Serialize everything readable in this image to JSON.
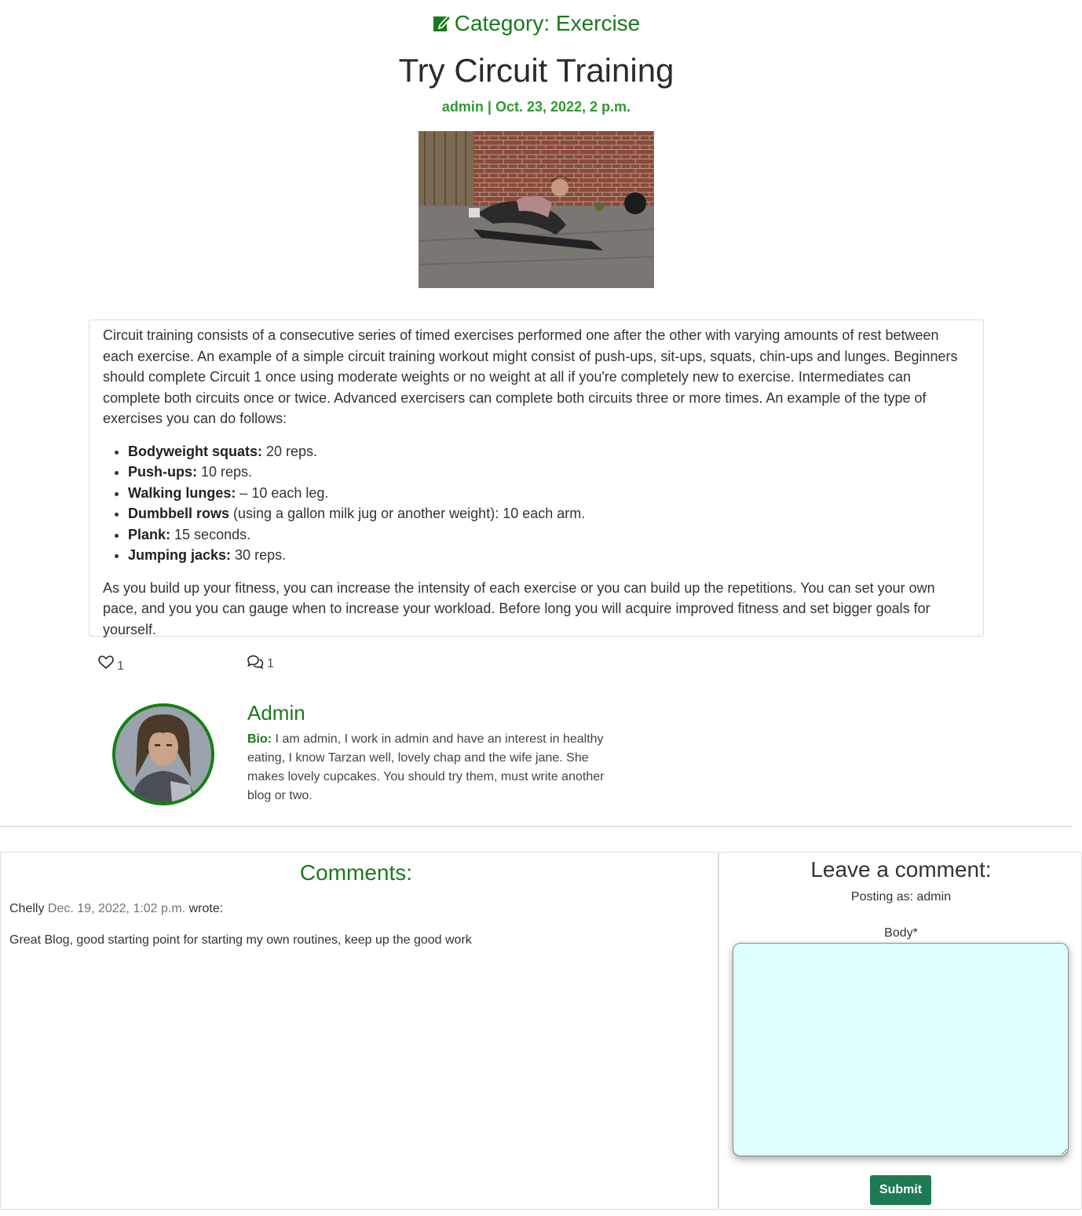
{
  "post": {
    "category_label": "Category: Exercise",
    "title": "Try Circuit Training",
    "meta": "admin | Oct. 23, 2022, 2 p.m.",
    "intro": "Circuit training consists of a consecutive series of timed exercises performed one after the other with varying amounts of rest between each exercise. An example of a simple circuit training workout might consist of push-ups, sit-ups, squats, chin-ups and lunges. Beginners should complete Circuit 1 once using moderate weights or no weight at all if you're completely new to exercise. Intermediates can complete both circuits once or twice. Advanced exercisers can complete both circuits three or more times. An example of the type of exercises you can do follows:",
    "exercises": [
      {
        "name": "Bodyweight squats:",
        "detail": " 20 reps."
      },
      {
        "name": "Push-ups:",
        "detail": " 10 reps."
      },
      {
        "name": "Walking lunges:",
        "detail": " – 10 each leg."
      },
      {
        "name": "Dumbbell rows",
        "detail": " (using a gallon milk jug or another weight): 10 each arm."
      },
      {
        "name": "Plank:",
        "detail": " 15 seconds."
      },
      {
        "name": "Jumping jacks:",
        "detail": " 30 reps."
      }
    ],
    "outro": "As you build up your fitness, you can increase the intensity of each exercise or you can build up the repetitions. You can set your own pace, and you you can gauge when to increase your workload. Before long you will acquire improved fitness and set bigger goals for yourself.",
    "likes": "1",
    "comment_count": "1"
  },
  "author": {
    "name": "Admin",
    "bio_label": "Bio:",
    "bio": " I am admin, I work in admin and have an interest in healthy eating, I know Tarzan well, lovely chap and the wife jane. She makes lovely cupcakes. You should try them, must write another blog or two."
  },
  "comments": {
    "title": "Comments:",
    "items": [
      {
        "author": "Chelly",
        "date": "Dec. 19, 2022, 1:02 p.m.",
        "suffix": "wrote:",
        "body": "Great Blog, good starting point for starting my own routines, keep up the good work"
      }
    ]
  },
  "form": {
    "title": "Leave a comment:",
    "posting_as": "Posting as: admin",
    "body_label": "Body*",
    "body_value": "",
    "submit_label": "Submit"
  },
  "colors": {
    "accent_green": "#1a7a1a",
    "meta_green": "#2e9a2e",
    "submit_bg": "#1d7a52",
    "textarea_bg": "#dffffe"
  },
  "icons": {
    "category": "edit-square-icon",
    "likes": "heart-outline-icon",
    "comments": "chat-bubbles-icon"
  }
}
